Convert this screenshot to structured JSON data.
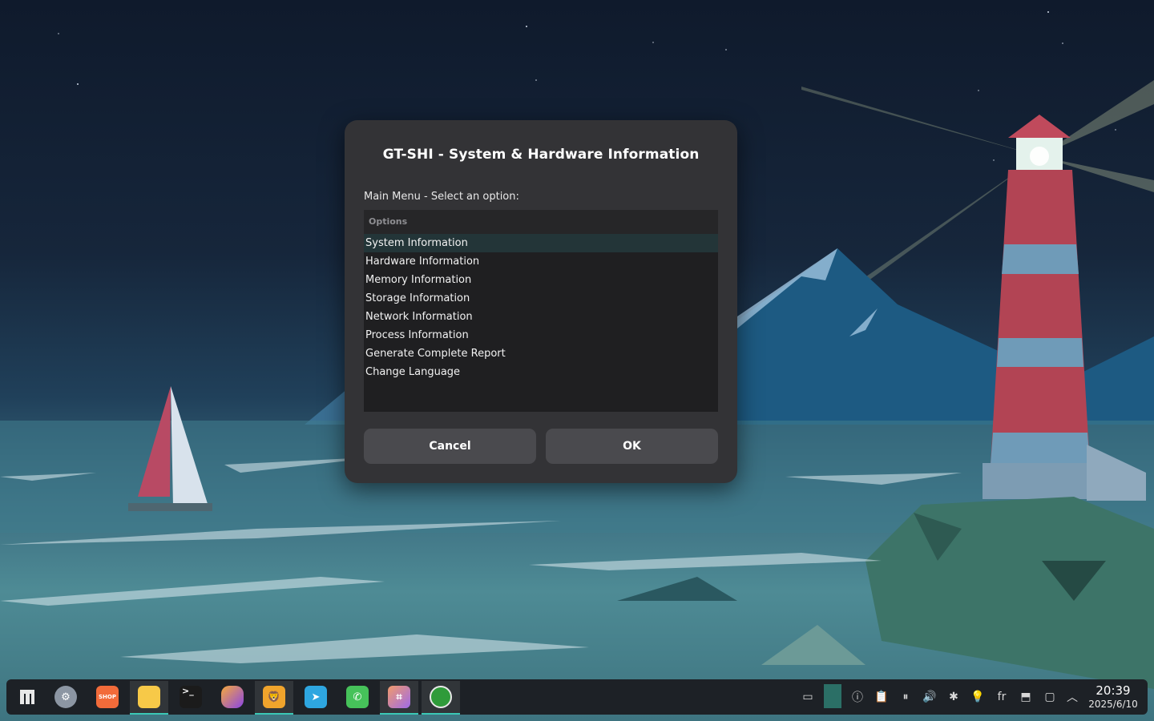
{
  "dialog": {
    "title": "GT-SHI - System & Hardware Information",
    "prompt": "Main Menu - Select an option:",
    "list_header": "Options",
    "options": [
      "System Information",
      "Hardware Information",
      "Memory Information",
      "Storage Information",
      "Network Information",
      "Process Information",
      "Generate Complete Report",
      "Change Language"
    ],
    "selected_index": 0,
    "cancel_label": "Cancel",
    "ok_label": "OK"
  },
  "taskbar": {
    "apps": [
      {
        "name": "app-menu-icon",
        "color": "#2b2f35"
      },
      {
        "name": "settings-icon",
        "color": "#8c96a3"
      },
      {
        "name": "shop-icon",
        "color": "#f26b3a",
        "label": "SHOP"
      },
      {
        "name": "file-manager-icon",
        "color": "#f7c948"
      },
      {
        "name": "terminal-icon",
        "color": "#1b1b1b",
        "label": ">_"
      },
      {
        "name": "firefox-icon",
        "color": "#8a45e6"
      },
      {
        "name": "brave-icon",
        "color": "#f0a42c"
      },
      {
        "name": "telegram-icon",
        "color": "#2ea6e0"
      },
      {
        "name": "whatsapp-icon",
        "color": "#46c25a"
      },
      {
        "name": "crop-tool-icon",
        "color": "#c274e6"
      },
      {
        "name": "gt-shi-icon",
        "color": "#2f9b3a"
      }
    ],
    "tray_language": "fr",
    "clock_time": "20:39",
    "clock_date": "2025/6/10",
    "accent_color": "#3ac7b5"
  }
}
